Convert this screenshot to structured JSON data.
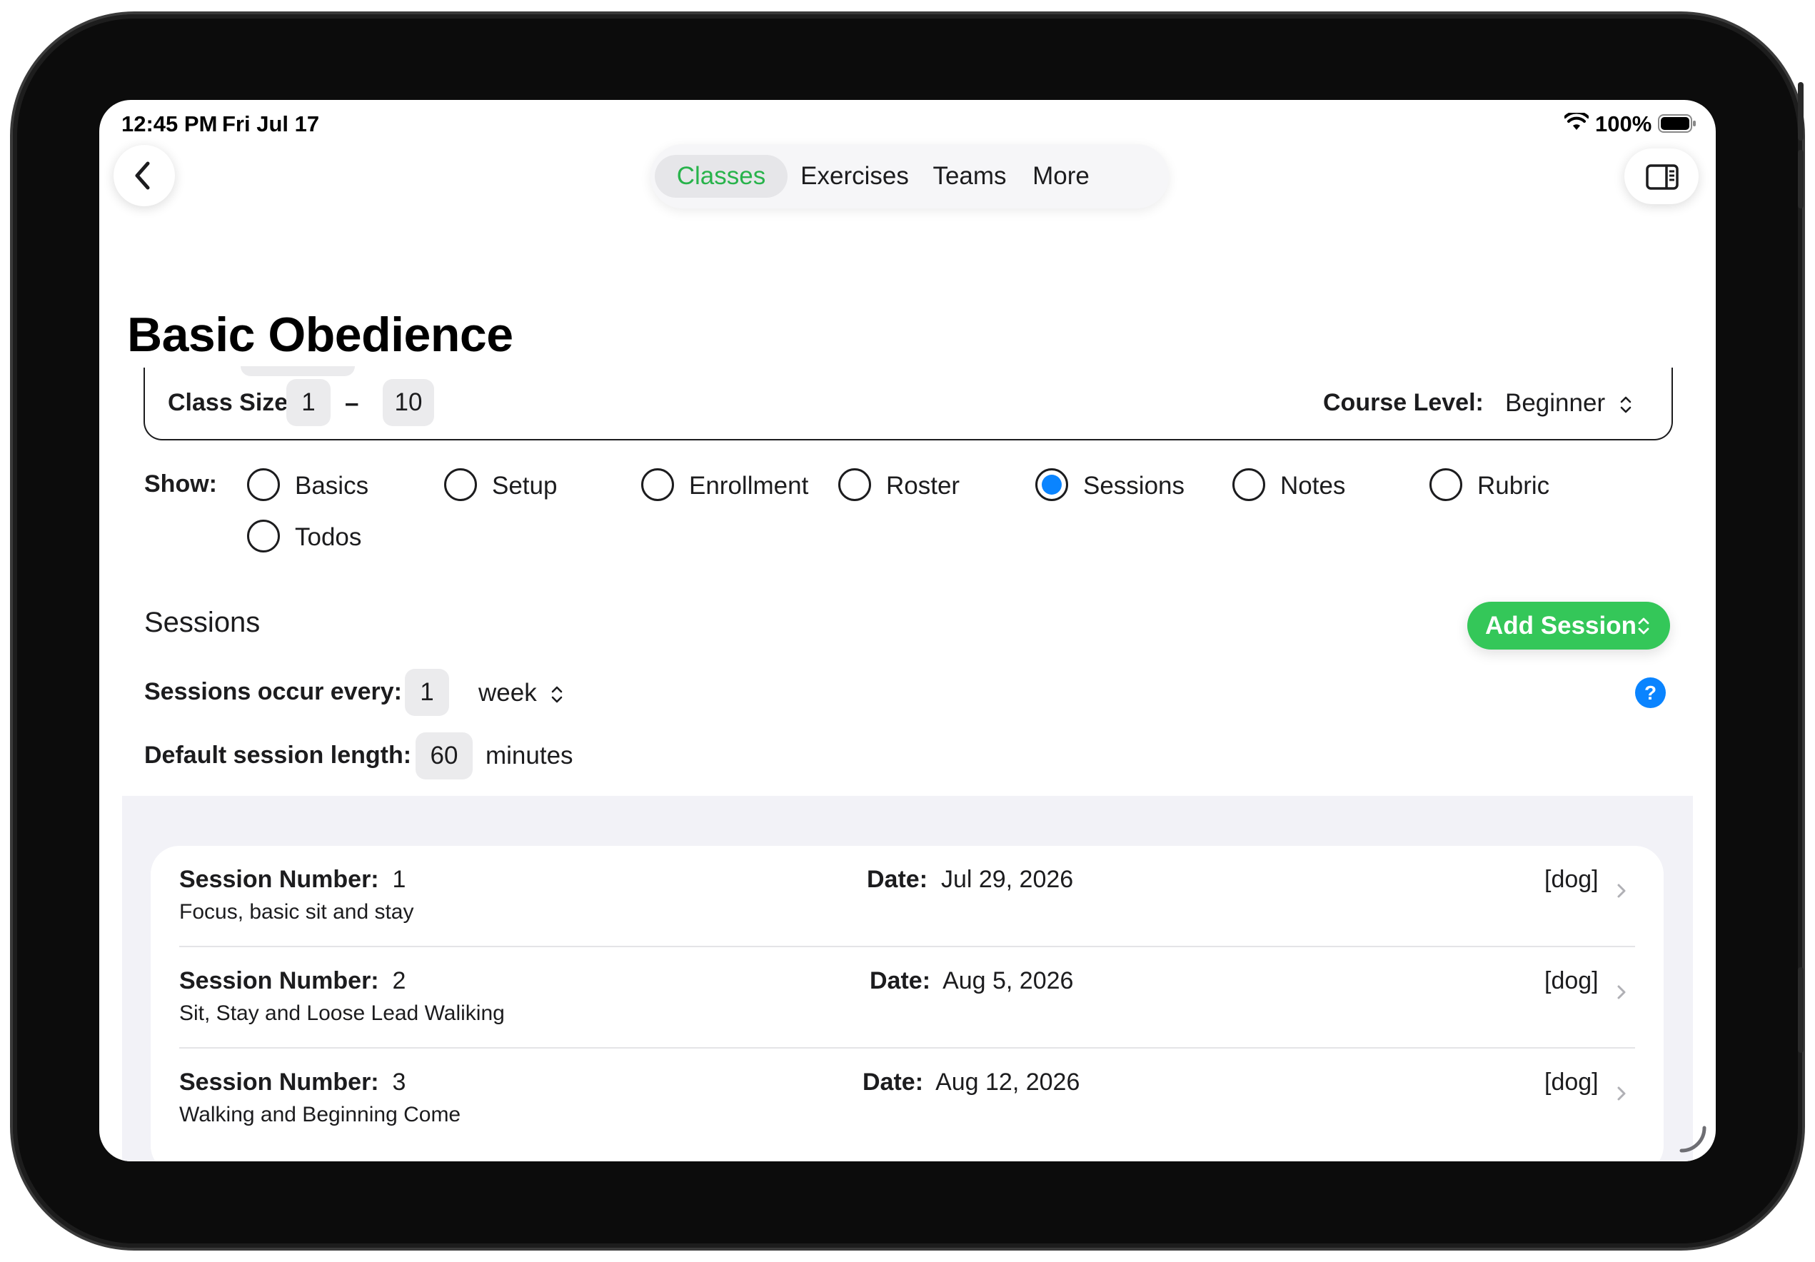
{
  "status_bar": {
    "time": "12:45 PM",
    "date": "Fri Jul 17",
    "battery": "100%"
  },
  "nav": {
    "tabs": [
      {
        "label": "Classes",
        "active": true
      },
      {
        "label": "Exercises",
        "active": false
      },
      {
        "label": "Teams",
        "active": false
      },
      {
        "label": "More",
        "active": false
      }
    ],
    "back_icon": "chevron-left-icon",
    "sidebar_icon": "sidebar-right-icon",
    "accent_color": "#28b34b"
  },
  "page_title": "Basic Obedience",
  "class_info": {
    "class_size_label": "Class Size:",
    "class_size_min": "1",
    "class_size_sep": "–",
    "class_size_max": "10",
    "course_level_label": "Course Level:",
    "course_level_value": "Beginner"
  },
  "show": {
    "label": "Show:",
    "options": [
      {
        "label": "Basics",
        "selected": false
      },
      {
        "label": "Setup",
        "selected": false
      },
      {
        "label": "Enrollment",
        "selected": false
      },
      {
        "label": "Roster",
        "selected": false
      },
      {
        "label": "Sessions",
        "selected": true
      },
      {
        "label": "Notes",
        "selected": false
      },
      {
        "label": "Rubric",
        "selected": false
      },
      {
        "label": "Todos",
        "selected": false
      }
    ]
  },
  "sessions": {
    "heading": "Sessions",
    "add_button": "Add Session",
    "occur_label": "Sessions occur every:",
    "occur_value": "1",
    "occur_unit": "week",
    "length_label": "Default session length:",
    "length_value": "60",
    "length_unit": "minutes",
    "help": "?",
    "add_color": "#34c759",
    "list": [
      {
        "number_label": "Session Number:",
        "number": "1",
        "description": "Focus, basic sit and stay",
        "date_label": "Date:",
        "date": "Jul 29, 2026",
        "tag": "[dog]"
      },
      {
        "number_label": "Session Number:",
        "number": "2",
        "description": "Sit, Stay and Loose Lead Waliking",
        "date_label": "Date:",
        "date": "Aug 5, 2026",
        "tag": "[dog]"
      },
      {
        "number_label": "Session Number:",
        "number": "3",
        "description": "Walking and Beginning Come",
        "date_label": "Date:",
        "date": "Aug 12, 2026",
        "tag": "[dog]"
      }
    ]
  }
}
